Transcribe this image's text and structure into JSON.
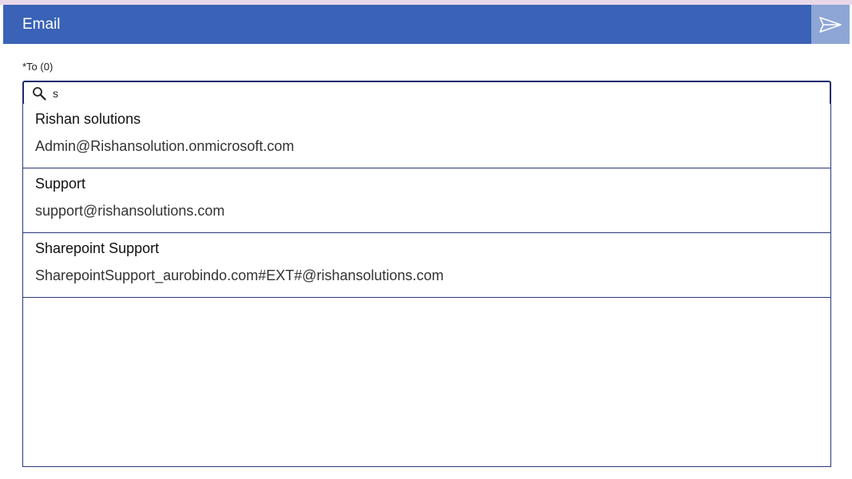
{
  "header": {
    "title": "Email",
    "send_icon": "send-icon",
    "color": "#3a62b6",
    "send_bg": "#8ea6d6"
  },
  "to_field": {
    "label": "*To (0)",
    "search_value": "s",
    "search_icon": "search-icon"
  },
  "results": [
    {
      "name": "Rishan solutions",
      "email": "Admin@Rishansolution.onmicrosoft.com"
    },
    {
      "name": "Support",
      "email": "support@rishansolutions.com"
    },
    {
      "name": "Sharepoint Support",
      "email": "SharepointSupport_aurobindo.com#EXT#@rishansolutions.com"
    }
  ]
}
